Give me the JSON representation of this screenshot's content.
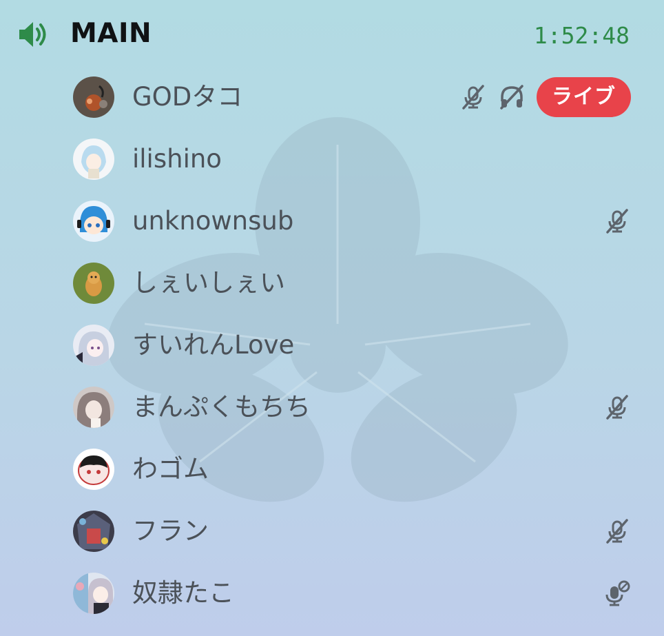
{
  "channel": {
    "name": "MAIN",
    "elapsed": "1:52:48",
    "accent_color": "#2e8b49",
    "icon": "speaker-icon"
  },
  "members": [
    {
      "name": "GODタコ",
      "avatar": "avatar-godtako",
      "server_muted": true,
      "deafened": true,
      "live": true,
      "live_label": "ライブ"
    },
    {
      "name": "ilishino",
      "avatar": "avatar-ilishino"
    },
    {
      "name": "unknownsub",
      "avatar": "avatar-unknownsub",
      "muted": true
    },
    {
      "name": "しぇいしぇい",
      "avatar": "avatar-sheisei"
    },
    {
      "name": "すいれんLove",
      "avatar": "avatar-suiren"
    },
    {
      "name": "まんぷくもちち",
      "avatar": "avatar-manpuku",
      "muted": true
    },
    {
      "name": "わゴム",
      "avatar": "avatar-wagomu"
    },
    {
      "name": "フラン",
      "avatar": "avatar-furan",
      "muted": true
    },
    {
      "name": "奴隷たこ",
      "avatar": "avatar-doreitako",
      "priority_speaker": true
    }
  ],
  "colors": {
    "live_badge": "#e8434a",
    "icon_gray": "#5d646c",
    "name_text": "#4b5158"
  }
}
